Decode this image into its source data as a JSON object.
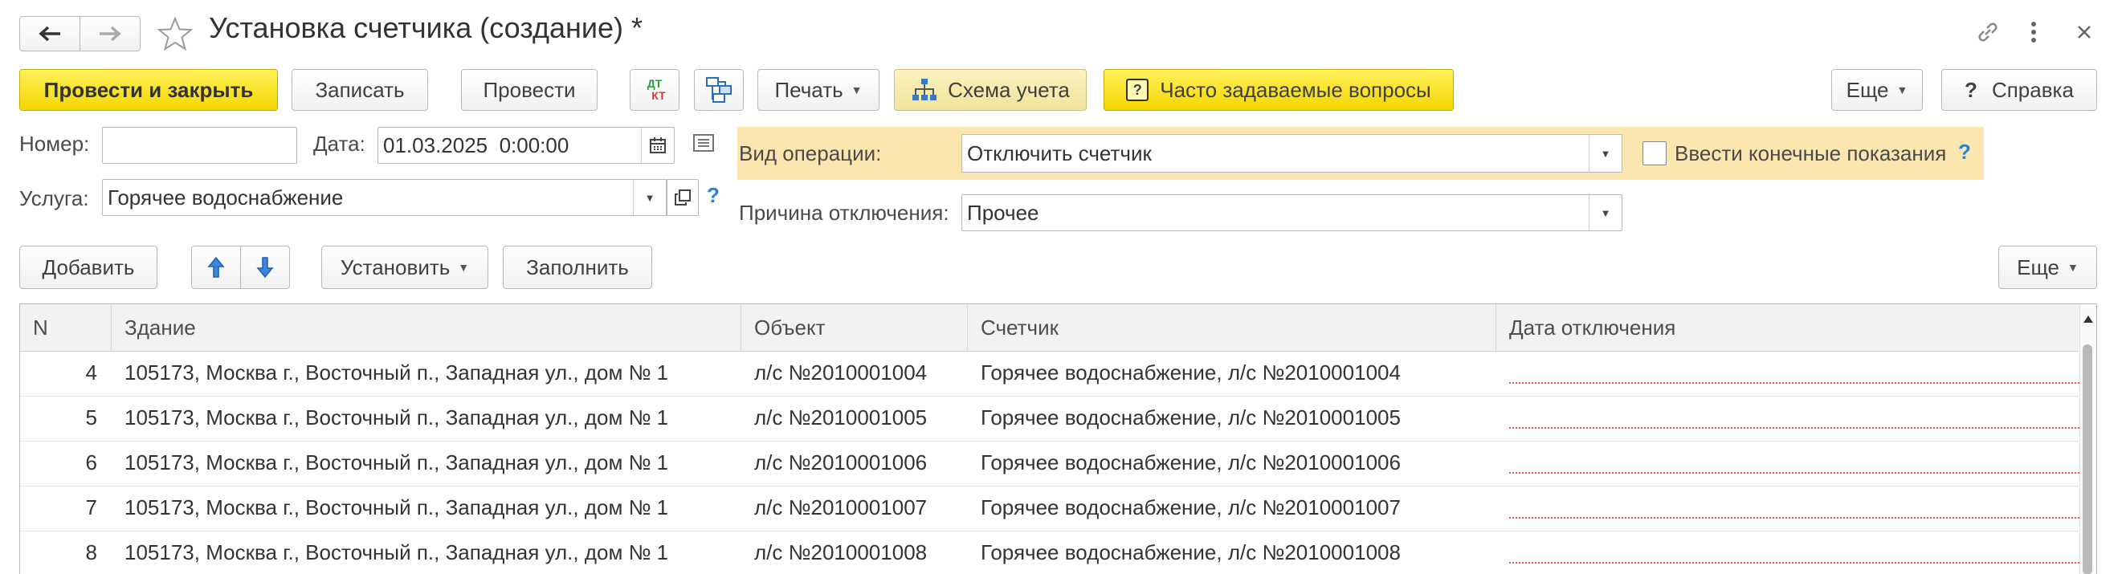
{
  "window": {
    "title": "Установка счетчика (создание) *"
  },
  "toolbar": {
    "post_close": "Провести и закрыть",
    "save": "Записать",
    "post": "Провести",
    "dtkt_top": "ДТ",
    "dtkt_bottom": "КТ",
    "print": "Печать",
    "scheme": "Схема учета",
    "faq": "Часто задаваемые вопросы",
    "more": "Еще",
    "help": "Справка"
  },
  "form": {
    "number_label": "Номер:",
    "number_value": "",
    "date_label": "Дата:",
    "date_value": "01.03.2025  0:00:00",
    "service_label": "Услуга:",
    "service_value": "Горячее водоснабжение",
    "operation_label": "Вид операции:",
    "operation_value": "Отключить счетчик",
    "final_readings_label": "Ввести конечные показания",
    "reason_label": "Причина отключения:",
    "reason_value": "Прочее",
    "help_mark": "?"
  },
  "table_toolbar": {
    "add": "Добавить",
    "install": "Установить",
    "fill": "Заполнить",
    "more": "Еще"
  },
  "table": {
    "columns": [
      "N",
      "Здание",
      "Объект",
      "Счетчик",
      "Дата отключения"
    ],
    "rows": [
      {
        "n": "4",
        "building": "105173, Москва г., Восточный п., Западная ул., дом № 1",
        "object": "л/с №2010001004",
        "meter": "Горячее водоснабжение, л/с №2010001004",
        "date": ""
      },
      {
        "n": "5",
        "building": "105173, Москва г., Восточный п., Западная ул., дом № 1",
        "object": "л/с №2010001005",
        "meter": "Горячее водоснабжение, л/с №2010001005",
        "date": ""
      },
      {
        "n": "6",
        "building": "105173, Москва г., Восточный п., Западная ул., дом № 1",
        "object": "л/с №2010001006",
        "meter": "Горячее водоснабжение, л/с №2010001006",
        "date": ""
      },
      {
        "n": "7",
        "building": "105173, Москва г., Восточный п., Западная ул., дом № 1",
        "object": "л/с №2010001007",
        "meter": "Горячее водоснабжение, л/с №2010001007",
        "date": ""
      },
      {
        "n": "8",
        "building": "105173, Москва г., Восточный п., Западная ул., дом № 1",
        "object": "л/с №2010001008",
        "meter": "Горячее водоснабжение, л/с №2010001008",
        "date": ""
      }
    ]
  },
  "colors": {
    "accent_yellow": "#f5d800",
    "operation_panel": "#fbe6b0",
    "help_blue": "#2d7fd6",
    "required_red": "#ea5050"
  }
}
